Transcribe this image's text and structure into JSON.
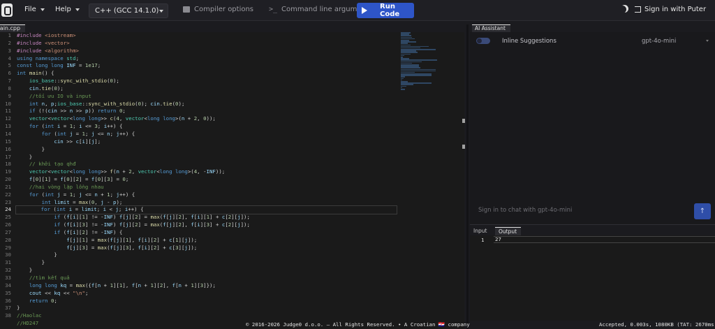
{
  "topbar": {
    "file_label": "File",
    "help_label": "Help",
    "compiler_select": "C++ (GCC 14.1.0)",
    "compiler_options_label": "Compiler options",
    "command_line_label": "Command line argument",
    "run_label": "Run Code",
    "signin_label": "Sign in with Puter",
    "accent_color": "#2e55c8"
  },
  "editor": {
    "tab_label": "main.cpp",
    "line_numbers": [
      "1",
      "2",
      "3",
      "4",
      "5",
      "6",
      "7",
      "8",
      "9",
      "10",
      "11",
      "12",
      "13",
      "14",
      "15",
      "16",
      "17",
      "18",
      "19",
      "20",
      "21",
      "22",
      "23",
      "24",
      "25",
      "26",
      "27",
      "28",
      "29",
      "30",
      "31",
      "32",
      "33",
      "34",
      "35",
      "36",
      "37",
      "38"
    ],
    "active_line": 24
  },
  "footer": {
    "copyright": "© 2016-2026 Judge0 d.o.o. – All Rights Reserved. • A Croatian 🇭🇷 company",
    "status": "Accepted, 0.003s, 1080KB (TAT: 2670ms)"
  },
  "ai": {
    "tab_label": "AI Assistant",
    "inline_suggestions_label": "Inline Suggestions",
    "model_label": "gpt-4o-mini",
    "chat_placeholder": "Sign in to chat with gpt-4o-mini",
    "send_icon": "arrow-up-icon"
  },
  "io": {
    "input_tab": "Input",
    "output_tab": "Output",
    "output_line_number": "1",
    "output_value": "27"
  }
}
